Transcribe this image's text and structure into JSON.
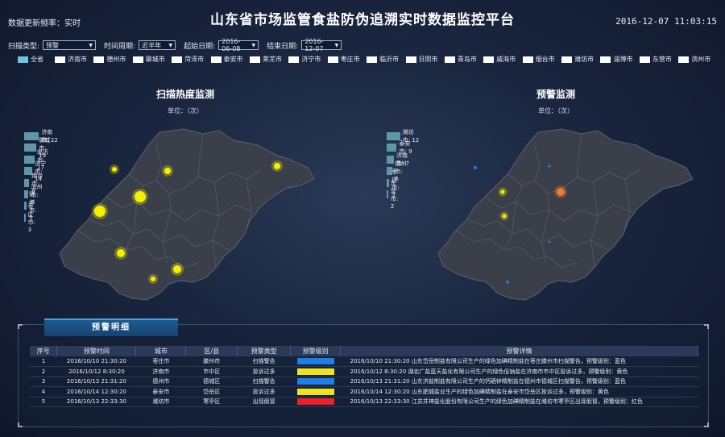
{
  "header": {
    "freq_label": "数据更新频率：实时",
    "title": "山东省市场监管食盐防伪追溯实时数据监控平台",
    "datetime": "2016-12-07 11:03:15"
  },
  "filters": {
    "scan_type_label": "扫描类型:",
    "scan_type_value": "预警",
    "time_period_label": "时间周期:",
    "time_period_value": "近半年",
    "start_date_label": "起始日期:",
    "start_date_value": "2016-06-08",
    "end_date_label": "结束日期:",
    "end_date_value": "2016-12-07"
  },
  "cities": [
    {
      "label": "全省",
      "active": true
    },
    {
      "label": "济南市",
      "active": false
    },
    {
      "label": "德州市",
      "active": false
    },
    {
      "label": "聊城市",
      "active": false
    },
    {
      "label": "菏泽市",
      "active": false
    },
    {
      "label": "泰安市",
      "active": false
    },
    {
      "label": "莱芜市",
      "active": false
    },
    {
      "label": "济宁市",
      "active": false
    },
    {
      "label": "枣庄市",
      "active": false
    },
    {
      "label": "临沂市",
      "active": false
    },
    {
      "label": "日照市",
      "active": false
    },
    {
      "label": "青岛市",
      "active": false
    },
    {
      "label": "威海市",
      "active": false
    },
    {
      "label": "烟台市",
      "active": false
    },
    {
      "label": "潍坊市",
      "active": false
    },
    {
      "label": "淄博市",
      "active": false
    },
    {
      "label": "东营市",
      "active": false
    },
    {
      "label": "滨州市",
      "active": false
    }
  ],
  "scan_section": {
    "title": "扫描热度监测",
    "unit": "单位：（次）",
    "bars": [
      {
        "label": "济南市: 22",
        "value": 22
      },
      {
        "label": "聊城市: 19",
        "value": 19
      },
      {
        "label": "临沂市: 17",
        "value": 17
      },
      {
        "label": "济宁市: 14",
        "value": 14
      },
      {
        "label": "烟台市: 9",
        "value": 9
      },
      {
        "label": "滨州市: 8",
        "value": 8
      },
      {
        "label": "德州市: 5",
        "value": 5
      },
      {
        "label": "枣庄市: 3",
        "value": 3
      }
    ]
  },
  "warn_section": {
    "title": "预警监测",
    "unit": "单位：（次）",
    "bars": [
      {
        "label": "潍坊市: 12",
        "value": 12
      },
      {
        "label": "泰安市: 9",
        "value": 9
      },
      {
        "label": "济南市: 7",
        "value": 7
      },
      {
        "label": "德州市: 6",
        "value": 6
      },
      {
        "label": "枣庄市: 3",
        "value": 3
      },
      {
        "label": "东营市: 2",
        "value": 2
      }
    ]
  },
  "detail_panel": {
    "tab": "预警明细",
    "columns": [
      "序号",
      "预警时间",
      "城市",
      "区/县",
      "预警类型",
      "预警级别",
      "预警详情"
    ],
    "rows": [
      {
        "no": "1",
        "time": "2016/10/10 21:30:20",
        "city": "枣庄市",
        "district": "滕州市",
        "type": "扫描警告",
        "level_color": "#1e7fe6",
        "detail": "2016/10/10 21:30:20 山东岱岳制盐有限公司生产的绿色加碘精制盐在枣庄滕州市扫描警告，预警级别：蓝色"
      },
      {
        "no": "2",
        "time": "2016/10/12 8:30:20",
        "city": "济南市",
        "district": "市中区",
        "type": "投诉过多",
        "level_color": "#f2e21a",
        "detail": "2016/10/12 8:30:20 湖北广盐蓝天盐化有限公司生产的绿色低钠盐在济南市市中区投诉过多，预警级别：黄色"
      },
      {
        "no": "3",
        "time": "2016/10/13 21:31:20",
        "city": "德州市",
        "district": "德城区",
        "type": "扫描警告",
        "level_color": "#1e7fe6",
        "detail": "2016/10/13 21:31:20 山东济盐制盐有限公司生产的钙硒锌精制盐在德州市德城区扫描警告，预警级别：蓝色"
      },
      {
        "no": "4",
        "time": "2016/10/14 12:30:20",
        "city": "泰安市",
        "district": "岱岳区",
        "type": "投诉过多",
        "level_color": "#f2e21a",
        "detail": "2016/10/14 12:30:20 山东肥城盐业生产的绿色加碘精制盐在泰安市岱岳区投诉过多，预警级别：黄色"
      },
      {
        "no": "5",
        "time": "2016/10/13 22:33:30",
        "city": "潍坊市",
        "district": "寒亭区",
        "type": "出现假冒",
        "level_color": "#f0202a",
        "detail": "2016/10/13 22:33:30 江苏井神盐化股份有限公司生产的绿色加碘精制盐在潍坊市寒亭区出现假冒，预警级别：红色"
      }
    ]
  },
  "colors": {
    "accent": "#6ec6de",
    "bar": "#5e97a8",
    "map_fill": "#3a3f4a",
    "hot": "#f5f000",
    "warn_blue": "#1e7fe6",
    "warn_orange": "#f07a30"
  }
}
